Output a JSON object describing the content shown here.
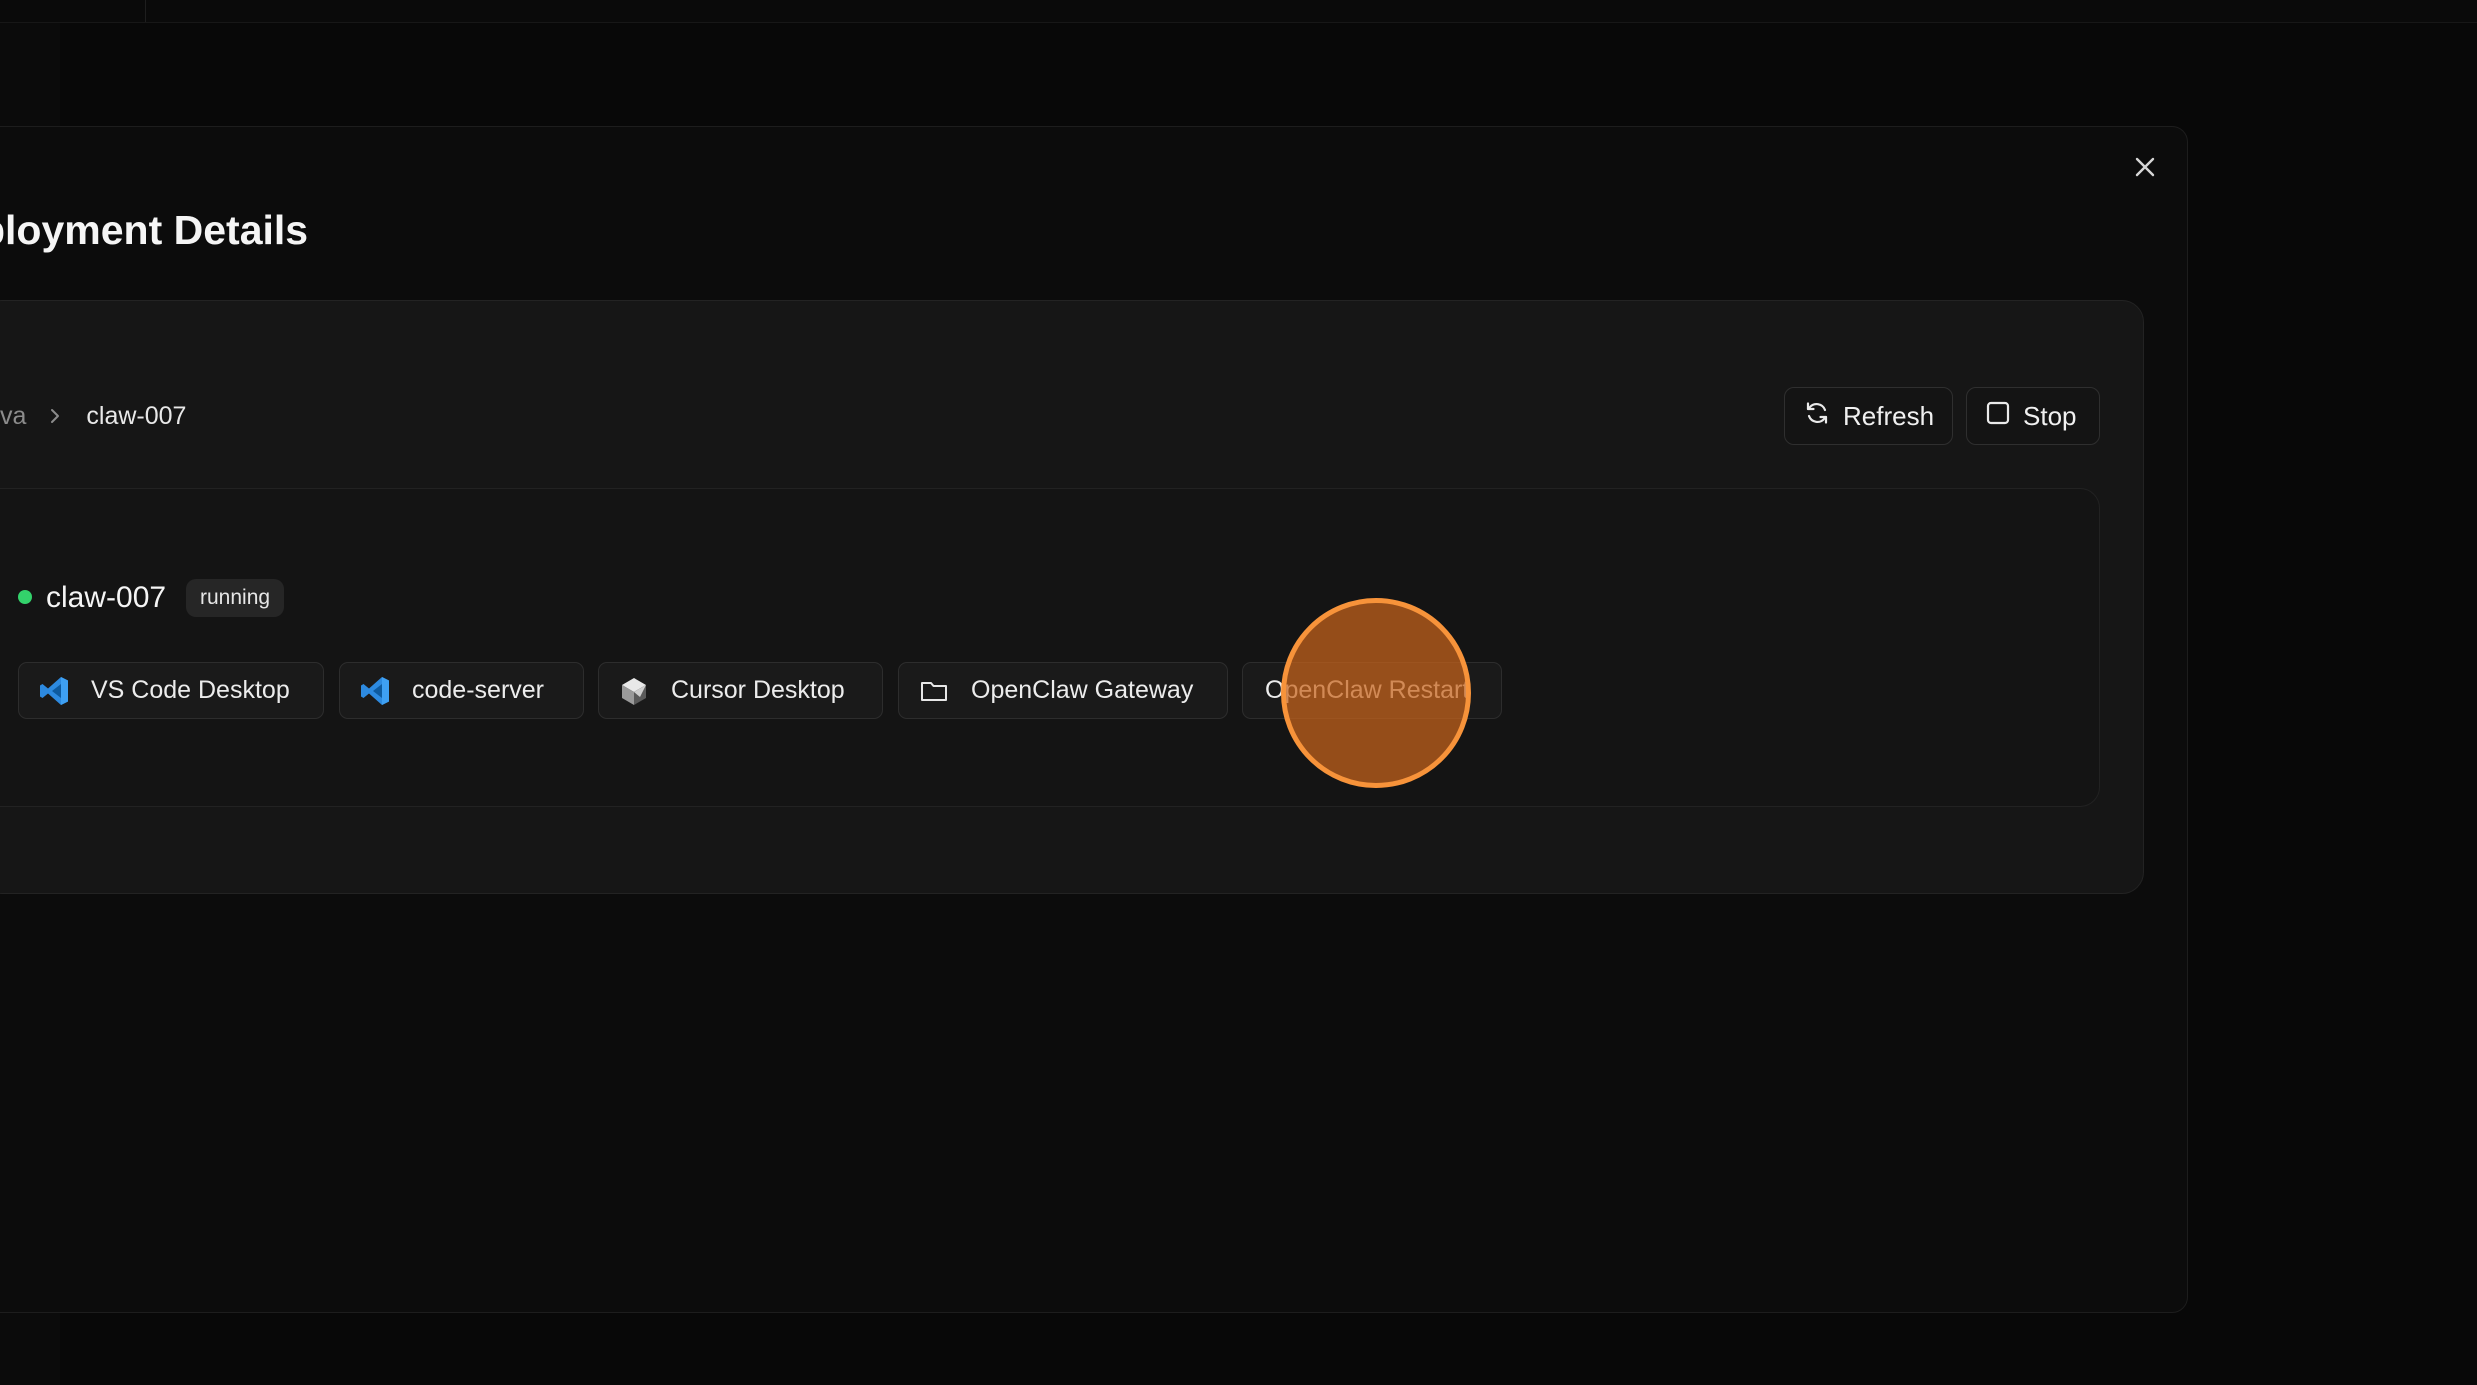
{
  "dialog": {
    "title": "ployment Details",
    "close_icon": "close-icon"
  },
  "breadcrumb": {
    "previous": "va",
    "separator_icon": "chevron-right-icon",
    "current": "claw-007"
  },
  "actions": {
    "refresh": {
      "label": "Refresh",
      "icon": "refresh-icon"
    },
    "stop": {
      "label": "Stop",
      "icon": "stop-icon"
    }
  },
  "deployment": {
    "name": "claw-007",
    "status": "running",
    "status_color": "#33d26b"
  },
  "apps": [
    {
      "label": "VS Code Desktop",
      "icon": "vscode-icon"
    },
    {
      "label": "code-server",
      "icon": "vscode-icon"
    },
    {
      "label": "Cursor Desktop",
      "icon": "cursor-icon"
    },
    {
      "label": "OpenClaw Gateway",
      "icon": "folder-icon"
    },
    {
      "label": "OpenClaw Restart",
      "icon": ""
    }
  ],
  "colors": {
    "background": "#080808",
    "card": "#161616",
    "accent_click": "#f7933a",
    "vscode_blue": "#2d8ae0"
  }
}
